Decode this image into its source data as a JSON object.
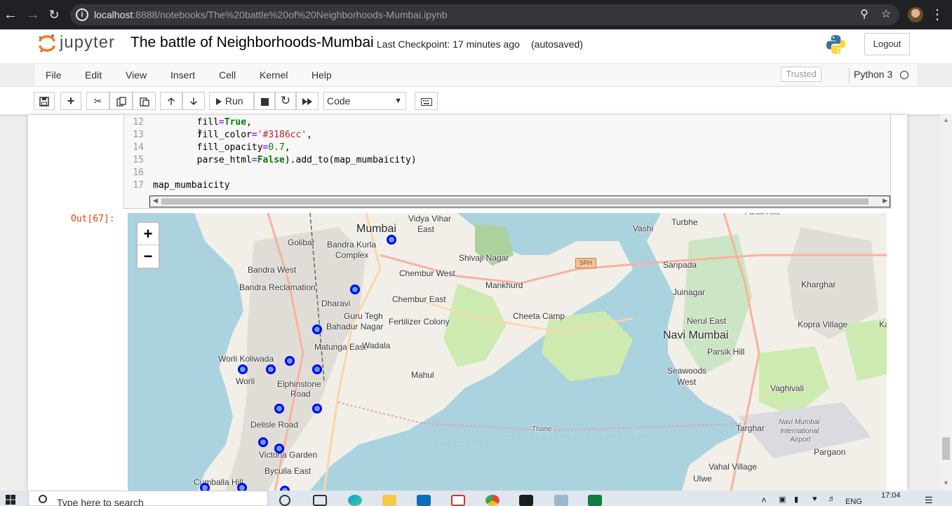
{
  "browser": {
    "url_host": "localhost",
    "url_rest": ":8888/notebooks/The%20battle%20of%20Neighborhoods-Mumbai.ipynb"
  },
  "header": {
    "logo_text": "jupyter",
    "notebook_title": "The battle of Neighborhoods-Mumbai",
    "checkpoint": "Last Checkpoint: 17 minutes ago",
    "autosave": "(autosaved)",
    "logout_label": "Logout"
  },
  "menubar": {
    "items": [
      "File",
      "Edit",
      "View",
      "Insert",
      "Cell",
      "Kernel",
      "Help"
    ],
    "trusted_label": "Trusted",
    "kernel_name": "Python 3"
  },
  "toolbar": {
    "run_label": "Run",
    "cell_type": "Code"
  },
  "code_cell": {
    "lines": [
      {
        "num": "12",
        "pre": "        ",
        "param": "fill",
        "eq": "=",
        "val": "True",
        "val_kind": "kw",
        "post": ","
      },
      {
        "num": "13",
        "pre": "        ",
        "param": "fill_color",
        "eq": "=",
        "val": "'#3186cc'",
        "val_kind": "st",
        "post": ","
      },
      {
        "num": "14",
        "pre": "        ",
        "param": "fill_opacity",
        "eq": "=",
        "val": "0.7",
        "val_kind": "nm",
        "post": ","
      },
      {
        "num": "15",
        "pre": "        ",
        "param": "parse_html",
        "eq": "=",
        "val": "False",
        "val_kind": "kw",
        "post": ").add_to(map_mumbaicity)"
      },
      {
        "num": "16",
        "pre": "",
        "param": "",
        "eq": "",
        "val": "",
        "val_kind": "",
        "post": ""
      },
      {
        "num": "17",
        "pre": "",
        "param": "map_mumbaicity",
        "eq": "",
        "val": "",
        "val_kind": "",
        "post": ""
      }
    ]
  },
  "output": {
    "prompt": "Out[67]:",
    "zoom_in": "+",
    "zoom_out": "−",
    "road_badge": "SPH",
    "places": [
      {
        "name": "Mumbai",
        "style": "big"
      },
      {
        "name": "Vidya Vihar",
        "style": ""
      },
      {
        "name": "East",
        "style": ""
      },
      {
        "name": "Golibar",
        "style": ""
      },
      {
        "name": "Bandra Kurla",
        "style": ""
      },
      {
        "name": "Complex",
        "style": ""
      },
      {
        "name": "Shivaji Nagar",
        "style": ""
      },
      {
        "name": "Bandra West",
        "style": ""
      },
      {
        "name": "Chembur West",
        "style": ""
      },
      {
        "name": "Mankhurd",
        "style": ""
      },
      {
        "name": "Bandra Reclamation",
        "style": ""
      },
      {
        "name": "Chembur East",
        "style": ""
      },
      {
        "name": "Dharavi",
        "style": ""
      },
      {
        "name": "Guru Tegh",
        "style": ""
      },
      {
        "name": "Bahadur Nagar",
        "style": ""
      },
      {
        "name": "Fertilizer Colony",
        "style": ""
      },
      {
        "name": "Cheeta Camp",
        "style": ""
      },
      {
        "name": "Matunga East",
        "style": ""
      },
      {
        "name": "Wadala",
        "style": ""
      },
      {
        "name": "Worli Koliwada",
        "style": ""
      },
      {
        "name": "Worli",
        "style": ""
      },
      {
        "name": "Elphinstone",
        "style": ""
      },
      {
        "name": "Road",
        "style": ""
      },
      {
        "name": "Mahul",
        "style": ""
      },
      {
        "name": "Delisle Road",
        "style": ""
      },
      {
        "name": "Victoria Garden",
        "style": ""
      },
      {
        "name": "Byculla East",
        "style": ""
      },
      {
        "name": "Cumballa Hill",
        "style": ""
      },
      {
        "name": "Thane",
        "style": "small"
      },
      {
        "name": "Vashi",
        "style": ""
      },
      {
        "name": "Turbhe",
        "style": ""
      },
      {
        "name": "Sanpada",
        "style": ""
      },
      {
        "name": "Juinagar",
        "style": ""
      },
      {
        "name": "Kharghar",
        "style": ""
      },
      {
        "name": "Nerul East",
        "style": ""
      },
      {
        "name": "Kopra Village",
        "style": ""
      },
      {
        "name": "Kalar",
        "style": ""
      },
      {
        "name": "Navi Mumbai",
        "style": "big"
      },
      {
        "name": "Parsik Hill",
        "style": ""
      },
      {
        "name": "Seawoods",
        "style": ""
      },
      {
        "name": "West",
        "style": ""
      },
      {
        "name": "Vaghivali",
        "style": ""
      },
      {
        "name": "Targhar",
        "style": ""
      },
      {
        "name": "Navi Mumbai",
        "style": "small"
      },
      {
        "name": "International",
        "style": "small"
      },
      {
        "name": "Airport",
        "style": "small"
      },
      {
        "name": "Pargaon",
        "style": ""
      },
      {
        "name": "Vahal Village",
        "style": ""
      },
      {
        "name": "Ulwe",
        "style": ""
      },
      {
        "name": "Parsik Hills",
        "style": "small"
      }
    ],
    "marker_count": 14
  },
  "taskbar": {
    "search_placeholder": "Type here to search",
    "language": "ENG",
    "time": "17:04"
  },
  "colors": {
    "marker_stroke": "#0000ff",
    "marker_fill": "#3186cc",
    "sea": "#aad3df",
    "land": "#f2efe9",
    "out_prompt": "#d84315"
  }
}
